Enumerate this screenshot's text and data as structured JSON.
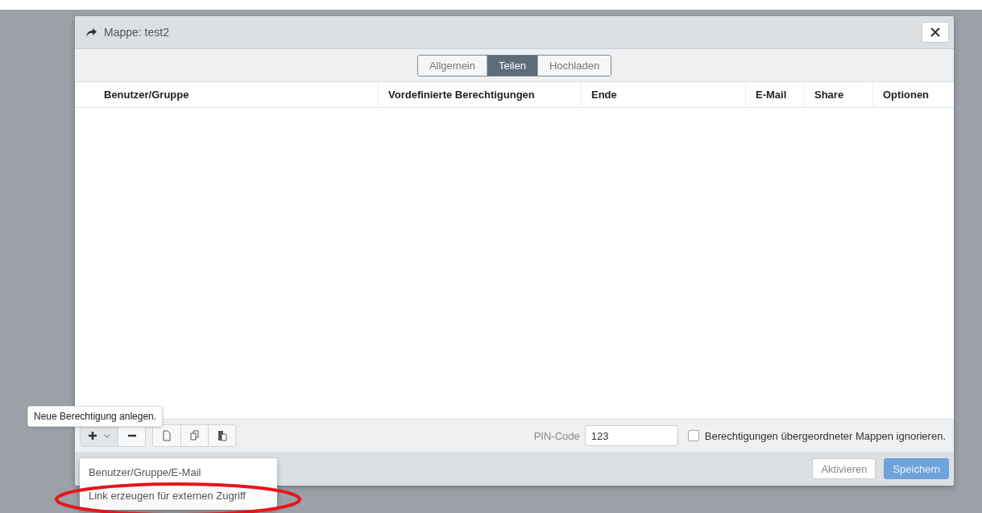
{
  "window": {
    "title": "Mappe: test2"
  },
  "tabs": [
    {
      "label": "Allgemein",
      "selected": false
    },
    {
      "label": "Teilen",
      "selected": true
    },
    {
      "label": "Hochladen",
      "selected": false
    }
  ],
  "table": {
    "columns": [
      "Benutzer/Gruppe",
      "Vordefinierte Berechtigungen",
      "Ende",
      "E-Mail",
      "Share",
      "Optionen"
    ]
  },
  "tooltip": "Neue Berechtigung anlegen.",
  "toolbar": {
    "pin_label": "PIN-Code",
    "pin_value": "123",
    "ignore_parent": {
      "label": "Berechtigungen übergeordneter Mappen ignorieren.",
      "checked": false
    }
  },
  "add_menu": {
    "items": [
      {
        "label": "Benutzer/Gruppe/E-Mail",
        "highlighted": false
      },
      {
        "label": "Link erzeugen für externen Zugriff",
        "highlighted": true
      }
    ]
  },
  "buttons": [
    {
      "label": "Aktivieren",
      "kind": "secondary"
    },
    {
      "label": "Speichern",
      "kind": "primary"
    }
  ]
}
